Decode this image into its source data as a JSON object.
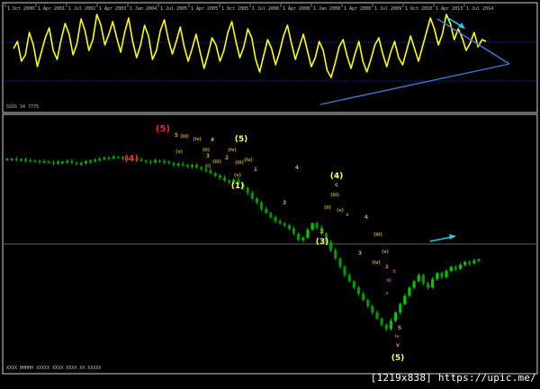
{
  "watermark": "[1219x838] https://upic.me/",
  "colors": {
    "background": "#000000",
    "oscillator": "#ffff00",
    "price": "#00c800",
    "trendline": "#3c78d8",
    "arrow": "#29c5e6",
    "wave_red": "#ff2020",
    "wave_yellow": "#ffff66",
    "wave_minor": "#c8a032",
    "wave_magenta": "#c040c0",
    "dotted_line": "#1e3cff",
    "grid_line": "#808080"
  },
  "top_panel": {
    "label": "SSSS 34 7775",
    "date_labels": [
      "1 Oct 2000",
      "1 Apr 2001",
      "1 Jul 2002",
      "1 Apr 2003",
      "1 Jan 2004",
      "1 Jul 2005",
      "1 Apr 2005",
      "1 Oct 2005",
      "1 Jul 2006",
      "1 Apr 2008",
      "1 Jan 2008",
      "1 Apr 2008",
      "1 Jul 2009",
      "1 Oct 2010",
      "1 Apr 2013",
      "1 Jul 2014"
    ]
  },
  "bottom_panel": {
    "label": "XXXX HHHHH  XXXXX  XXXX XXXX XX XXXXX"
  },
  "chart_data": [
    {
      "type": "line",
      "title": "",
      "series": [
        {
          "values": [
            62,
            70,
            48,
            55,
            80,
            66,
            42,
            58,
            74,
            85,
            60,
            50,
            72,
            90,
            78,
            55,
            68,
            95,
            82,
            60,
            72,
            100,
            88,
            66,
            78,
            92,
            74,
            58,
            80,
            96,
            70,
            52,
            66,
            88,
            76,
            50,
            60,
            82,
            94,
            72,
            56,
            70,
            86,
            64,
            48,
            62,
            78,
            58,
            40,
            56,
            74,
            66,
            48,
            60,
            80,
            92,
            70,
            52,
            64,
            84,
            74,
            50,
            36,
            54,
            72,
            62,
            44,
            58,
            76,
            88,
            68,
            50,
            64,
            78,
            60,
            42,
            52,
            70,
            60,
            38,
            30,
            46,
            64,
            72,
            54,
            40,
            56,
            70,
            48,
            36,
            50,
            66,
            74,
            56,
            42,
            58,
            70,
            52,
            44,
            60,
            76,
            62,
            48,
            64,
            80,
            96,
            84,
            66,
            78,
            100,
            90,
            72,
            84,
            74,
            60,
            68,
            80,
            64,
            72,
            70
          ]
        }
      ]
    },
    {
      "type": "line",
      "title": "",
      "series": [
        {
          "values": [
            1000,
            1000,
            998,
            999,
            997,
            996,
            995,
            993,
            994,
            992,
            990,
            992,
            993,
            995,
            991,
            988,
            990,
            994,
            996,
            998,
            1000,
            1003,
            1002,
            1005,
            1004,
            1002,
            1000,
            1001,
            999,
            996,
            994,
            992,
            996,
            995,
            992,
            990,
            986,
            988,
            985,
            982,
            985,
            980,
            976,
            972,
            966,
            960,
            955,
            948,
            944,
            950,
            940,
            930,
            918,
            905,
            895,
            880,
            870,
            860,
            850,
            845,
            840,
            832,
            820,
            805,
            810,
            830,
            845,
            835,
            820,
            800,
            780,
            760,
            740,
            720,
            705,
            690,
            675,
            660,
            645,
            630,
            615,
            600,
            590,
            610,
            630,
            650,
            670,
            690,
            705,
            720,
            700,
            690,
            710,
            725,
            715,
            730,
            740,
            735,
            745,
            752,
            748,
            755,
            758
          ]
        }
      ]
    }
  ],
  "wave_labels": [
    {
      "text": "(4)",
      "color_key": "wave_red"
    },
    {
      "text": "(5)",
      "color_key": "wave_red"
    },
    {
      "text": "(5)",
      "color_key": "wave_yellow"
    },
    {
      "text": "(1)",
      "color_key": "wave_yellow"
    },
    {
      "text": "(4)",
      "color_key": "wave_yellow"
    },
    {
      "text": "(3)",
      "color_key": "wave_yellow"
    },
    {
      "text": "(5)",
      "color_key": "wave_yellow"
    },
    {
      "text": "5",
      "color_key": "wave_minor"
    },
    {
      "text": "4",
      "color_key": "wave_minor"
    },
    {
      "text": "3",
      "color_key": "wave_minor"
    },
    {
      "text": "2",
      "color_key": "wave_minor"
    },
    {
      "text": "1",
      "color_key": "wave_minor"
    },
    {
      "text": "4",
      "color_key": "wave_minor"
    },
    {
      "text": "3",
      "color_key": "wave_minor"
    },
    {
      "text": "2",
      "color_key": "wave_minor"
    },
    {
      "text": "3",
      "color_key": "wave_minor"
    },
    {
      "text": "4",
      "color_key": "wave_minor"
    },
    {
      "text": "5",
      "color_key": "wave_minor"
    },
    {
      "text": "c",
      "color_key": "wave_minor"
    },
    {
      "text": "(iii)",
      "color_key": "wave_minor"
    },
    {
      "text": "(iv)",
      "color_key": "wave_minor"
    },
    {
      "text": "(v)",
      "color_key": "wave_minor"
    },
    {
      "text": "(ii)",
      "color_key": "wave_minor"
    },
    {
      "text": "(i)",
      "color_key": "wave_minor"
    },
    {
      "text": "(iii)",
      "color_key": "wave_minor"
    },
    {
      "text": "(iv)",
      "color_key": "wave_minor"
    },
    {
      "text": "(iii)",
      "color_key": "wave_minor"
    },
    {
      "text": "(iv)",
      "color_key": "wave_minor"
    },
    {
      "text": "(v)",
      "color_key": "wave_minor"
    },
    {
      "text": "(iii)",
      "color_key": "wave_minor"
    },
    {
      "text": "(ii)",
      "color_key": "wave_minor"
    },
    {
      "text": "(v)",
      "color_key": "wave_minor"
    },
    {
      "text": "c",
      "color_key": "wave_minor"
    },
    {
      "text": "(iii)",
      "color_key": "wave_minor"
    },
    {
      "text": "(iv)",
      "color_key": "wave_minor"
    },
    {
      "text": "(v)",
      "color_key": "wave_minor"
    },
    {
      "text": "2",
      "color_key": "wave_minor"
    },
    {
      "text": "v",
      "color_key": "wave_minor"
    },
    {
      "text": "iv",
      "color_key": "wave_magenta"
    },
    {
      "text": "ii",
      "color_key": "wave_magenta"
    },
    {
      "text": "iii",
      "color_key": "wave_magenta"
    },
    {
      "text": "v",
      "color_key": "wave_magenta"
    }
  ]
}
